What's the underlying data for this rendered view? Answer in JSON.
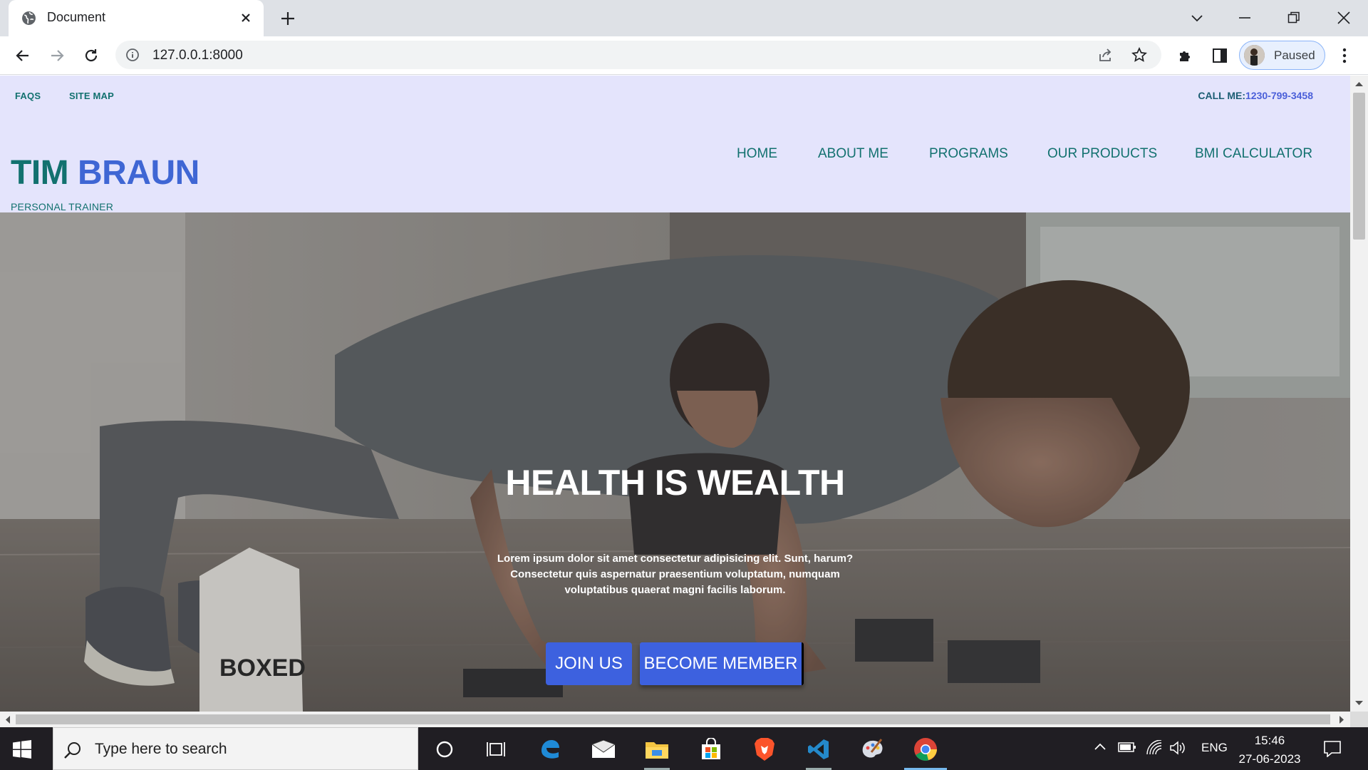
{
  "browser": {
    "tab_title": "Document",
    "url": "127.0.0.1:8000",
    "profile_label": "Paused",
    "accent": "#8ab4f8"
  },
  "site": {
    "top_links": [
      "FAQS",
      "SITE MAP"
    ],
    "call_label": "CALL ME:",
    "call_number": "1230-799-3458",
    "brand_first": "TIM",
    "brand_last": "BRAUN",
    "tagline": "PERSONAL TRAINER",
    "nav": [
      "HOME",
      "ABOUT ME",
      "PROGRAMS",
      "OUR PRODUCTS",
      "BMI CALCULATOR"
    ],
    "colors": {
      "teal": "#12716f",
      "blue": "#3f66d4",
      "header_bg": "#e4e4fc",
      "button": "#3d61df"
    }
  },
  "hero": {
    "title": "HEALTH IS WEALTH",
    "text_line1": "Lorem ipsum dolor sit amet consectetur adipisicing elit. Sunt, harum?",
    "text_line2": "Consectetur quis aspernatur praesentium voluptatum, numquam",
    "text_line3": "voluptatibus quaerat magni facilis laborum.",
    "join_label": "JOIN US",
    "member_label": "BECOME MEMBER",
    "carton_text": "BOXED"
  },
  "taskbar": {
    "search_placeholder": "Type here to search",
    "language": "ENG",
    "time": "15:46",
    "date": "27-06-2023"
  }
}
